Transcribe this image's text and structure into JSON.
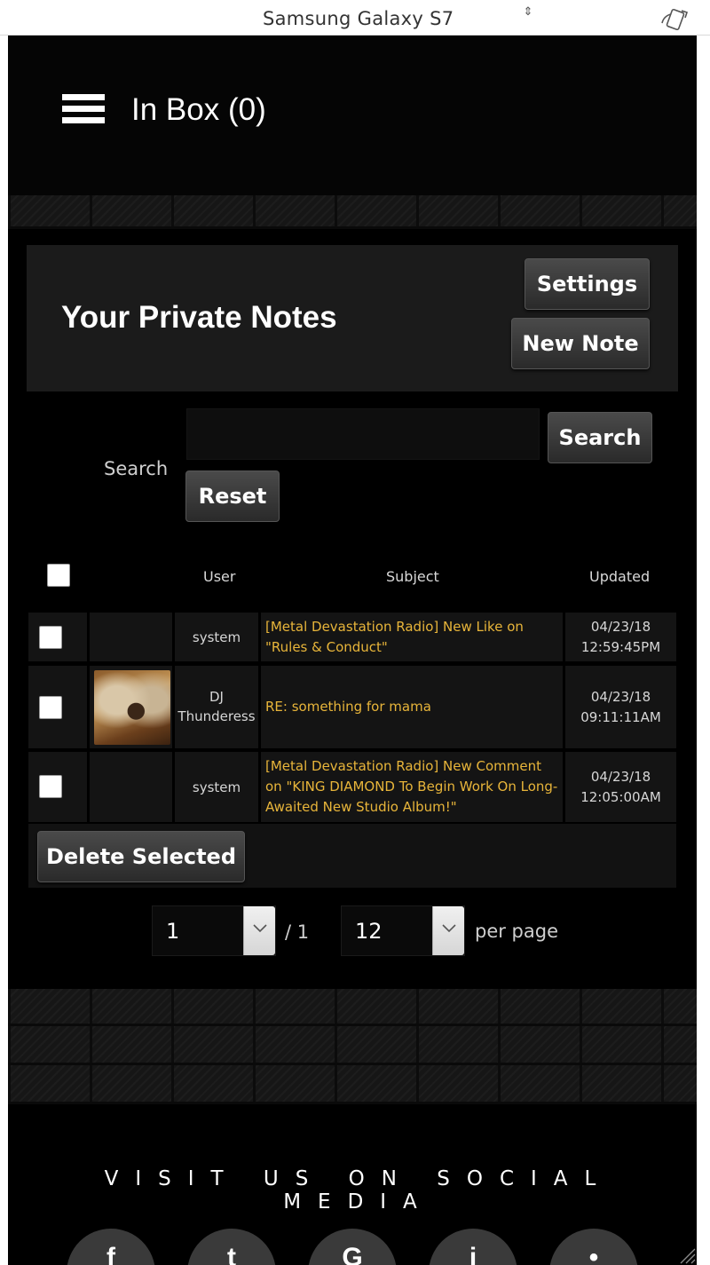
{
  "device_bar": {
    "device_name": "Samsung Galaxy S7",
    "arrows": "⇕"
  },
  "header": {
    "title": "In Box (0)"
  },
  "notes_panel": {
    "heading": "Your Private Notes",
    "settings_label": "Settings",
    "new_note_label": "New Note"
  },
  "search": {
    "label": "Search",
    "value": "",
    "search_label": "Search",
    "reset_label": "Reset"
  },
  "table": {
    "columns": [
      "User",
      "Subject",
      "Updated"
    ],
    "rows": [
      {
        "user": "system",
        "has_avatar": false,
        "subject": "[Metal Devastation Radio] New Like on \"Rules & Conduct\"",
        "updated_date": "04/23/18",
        "updated_time": "12:59:45PM"
      },
      {
        "user": "DJ Thunderess",
        "has_avatar": true,
        "subject": "RE: something for mama",
        "updated_date": "04/23/18",
        "updated_time": "09:11:11AM"
      },
      {
        "user": "system",
        "has_avatar": false,
        "subject": "[Metal Devastation Radio] New Comment on \"KING DIAMOND To Begin Work On Long-Awaited New Studio Album!\"",
        "updated_date": "04/23/18",
        "updated_time": "12:05:00AM"
      }
    ],
    "delete_label": "Delete Selected"
  },
  "pager": {
    "page": "1",
    "of_text": "/ 1",
    "per_page": "12",
    "per_page_label": "per page"
  },
  "social": {
    "title": "VISIT US ON SOCIAL MEDIA",
    "icons": [
      "facebook-icon",
      "twitter-icon",
      "google-plus-icon",
      "instagram-icon",
      "other-icon"
    ]
  },
  "colors": {
    "background": "#000000",
    "panel": "#1b1b1b",
    "row": "#141414",
    "subject_link": "#e8b53a",
    "button_top": "#4a4a4a",
    "button_bottom": "#2a2a2a"
  }
}
